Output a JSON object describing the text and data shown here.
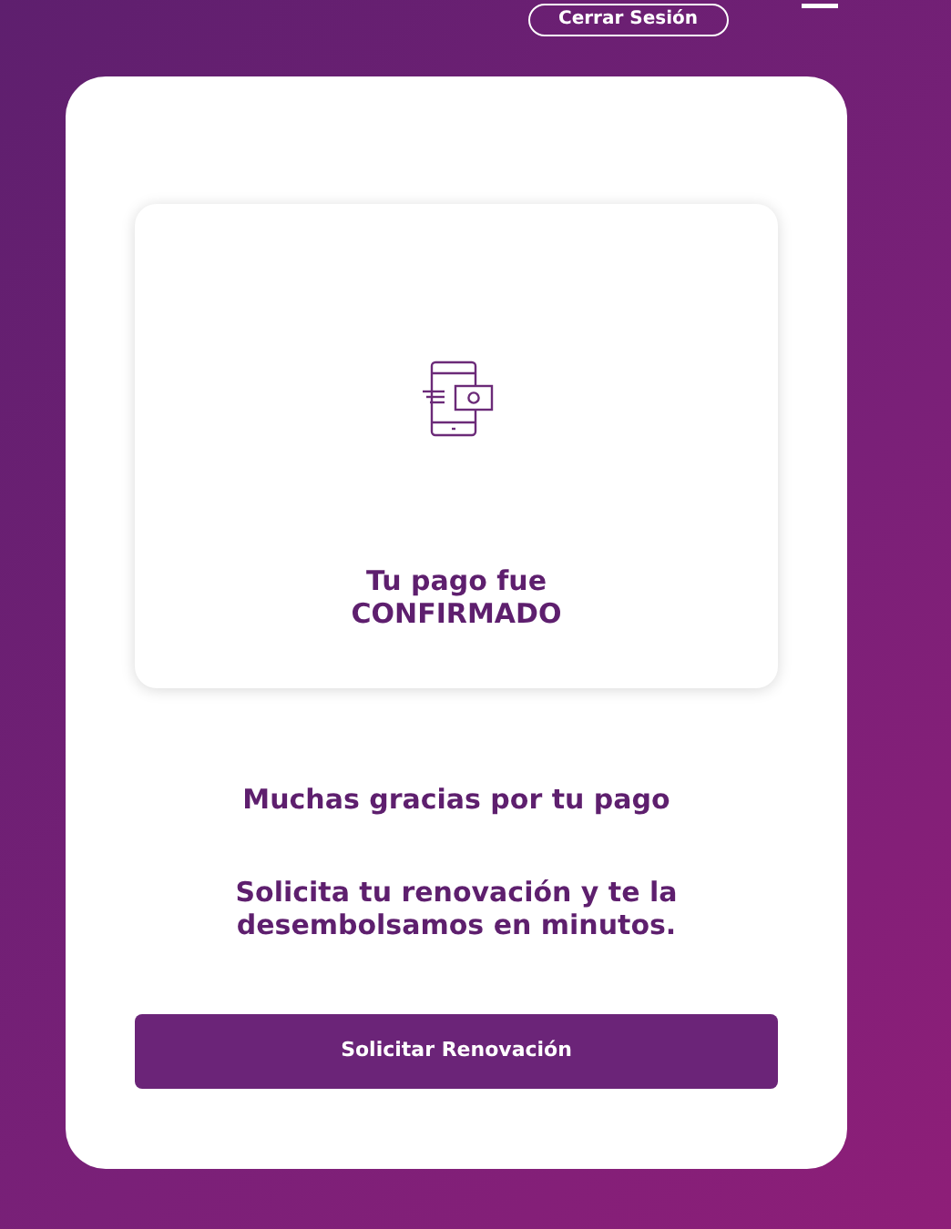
{
  "header": {
    "logout_button": "Cerrar Sesión"
  },
  "status_card": {
    "line_1": "Tu pago fue",
    "line_2": "CONFIRMADO"
  },
  "thanks": "Muchas gracias por tu pago",
  "message": "Solicita tu renovación y te la desembolsamos en minutos.",
  "action_button": "Solicitar Renovación"
}
